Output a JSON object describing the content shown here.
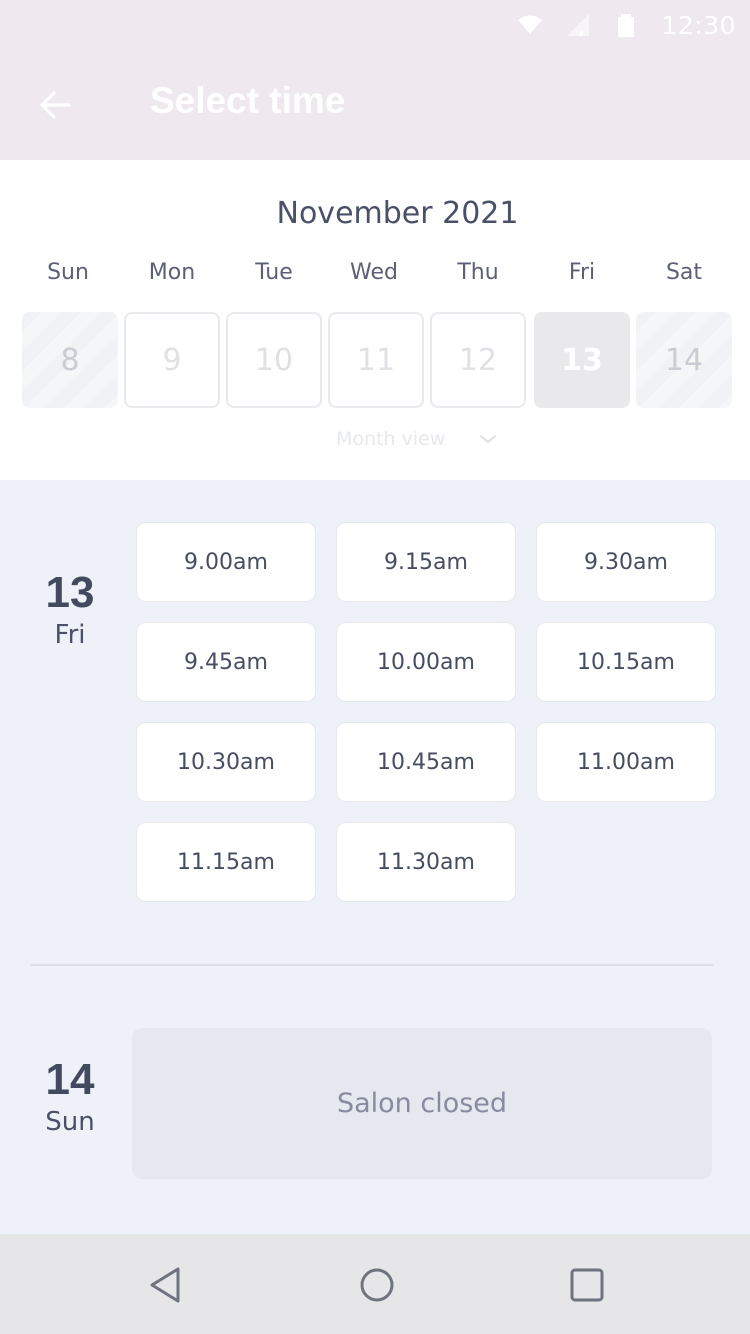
{
  "status_bar": {
    "time": "12:30",
    "icons": [
      "wifi-icon",
      "signal-icon",
      "battery-icon"
    ]
  },
  "header": {
    "title": "Select time",
    "back_icon": "arrow-left-icon"
  },
  "calendar": {
    "month_title": "November 2021",
    "weekdays": [
      "Sun",
      "Mon",
      "Tue",
      "Wed",
      "Thu",
      "Fri",
      "Sat"
    ],
    "days": [
      {
        "label": "8",
        "state": "past"
      },
      {
        "label": "9",
        "state": "unavailable"
      },
      {
        "label": "10",
        "state": "unavailable"
      },
      {
        "label": "11",
        "state": "unavailable"
      },
      {
        "label": "12",
        "state": "unavailable"
      },
      {
        "label": "13",
        "state": "selected"
      },
      {
        "label": "14",
        "state": "past"
      }
    ],
    "month_view_label": "Month view",
    "month_view_icon": "chevron-down-icon"
  },
  "schedule": [
    {
      "date": "13",
      "day": "Fri",
      "slots": [
        "9.00am",
        "9.15am",
        "9.30am",
        "9.45am",
        "10.00am",
        "10.15am",
        "10.30am",
        "10.45am",
        "11.00am",
        "11.15am",
        "11.30am"
      ]
    },
    {
      "date": "14",
      "day": "Sun",
      "closed_text": "Salon closed"
    }
  ],
  "nav_bar": {
    "icons": [
      "back-triangle-icon",
      "home-circle-icon",
      "recents-square-icon"
    ]
  },
  "colors": {
    "header_bg": "#efe8ef",
    "content_bg": "#eef1f8",
    "selected_day_bg": "#e9e9ec",
    "closed_bg": "#e6e8ef"
  }
}
